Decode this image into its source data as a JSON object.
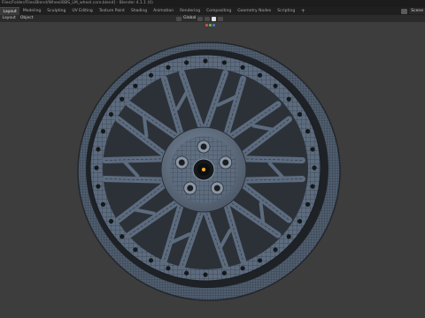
{
  "window": {
    "title": "Files/Folder/Files/Blend/Wheel/BBS_LM_wheel.core.blend] - Blender 4.1.1 (0)"
  },
  "workspaces": {
    "tabs": [
      {
        "label": "Layout",
        "active": true
      },
      {
        "label": "Modeling",
        "active": false
      },
      {
        "label": "Sculpting",
        "active": false
      },
      {
        "label": "UV Editing",
        "active": false
      },
      {
        "label": "Texture Paint",
        "active": false
      },
      {
        "label": "Shading",
        "active": false
      },
      {
        "label": "Animation",
        "active": false
      },
      {
        "label": "Rendering",
        "active": false
      },
      {
        "label": "Compositing",
        "active": false
      },
      {
        "label": "Geometry Nodes",
        "active": false
      },
      {
        "label": "Scripting",
        "active": false
      }
    ],
    "add_label": "+",
    "scene_label": "Scene"
  },
  "header": {
    "menus": [
      "Layout",
      "Object"
    ],
    "transform_orientation": "Global"
  },
  "viewport": {
    "subject": "wheel-wireframe",
    "background_color": "#3d3d3d",
    "mesh_color": "#5c6b7e",
    "wire_color": "#2a3038",
    "rim_dark_color": "#1e2226"
  }
}
